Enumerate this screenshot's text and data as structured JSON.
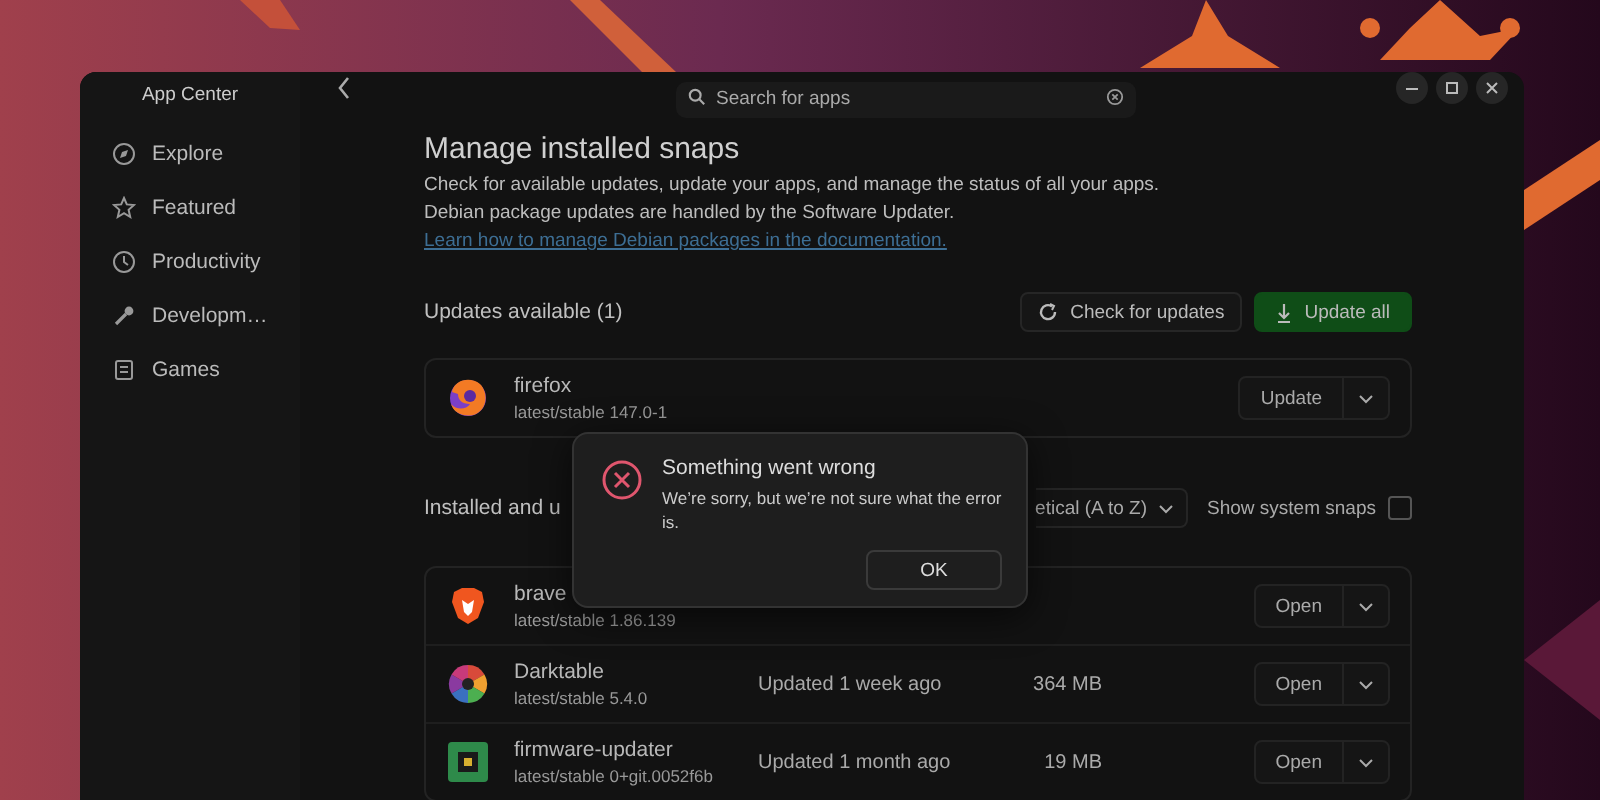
{
  "sidebar": {
    "title": "App Center",
    "items": [
      {
        "label": "Explore",
        "selected": false
      },
      {
        "label": "Featured",
        "selected": false
      },
      {
        "label": "Productivity",
        "selected": false
      },
      {
        "label": "Developm…",
        "selected": false
      },
      {
        "label": "Games",
        "selected": false
      }
    ]
  },
  "search": {
    "placeholder": "Search for apps"
  },
  "page": {
    "title": "Manage installed snaps",
    "lines": [
      "Check for available updates, update your apps, and manage the status of all your apps.",
      "Debian package updates are handled by the Software Updater."
    ],
    "link": "Learn how to manage Debian packages in the documentation."
  },
  "updates": {
    "heading": "Updates available (1)",
    "check_button": "Check for updates",
    "update_all_button": "Update all",
    "items": [
      {
        "name": "firefox",
        "channel": "latest/stable 147.0-1",
        "action": "Update"
      }
    ]
  },
  "installed": {
    "heading": "Installed and u",
    "sort": "etical (A to Z)",
    "show_system_snaps": {
      "label": "Show system snaps",
      "checked": false
    },
    "items": [
      {
        "name": "brave",
        "channel": "latest/stable 1.86.139",
        "action": "Open"
      },
      {
        "name": "Darktable",
        "channel": "latest/stable 5.4.0",
        "updated": "Updated 1 week ago",
        "size": "364 MB",
        "action": "Open"
      },
      {
        "name": "firmware-updater",
        "channel": "latest/stable 0+git.0052f6b",
        "updated": "Updated 1 month ago",
        "size": "19 MB",
        "action": "Open"
      }
    ]
  },
  "dialog": {
    "title": "Something went wrong",
    "message": "We’re sorry, but we’re not sure what the error is.",
    "button": "OK"
  }
}
